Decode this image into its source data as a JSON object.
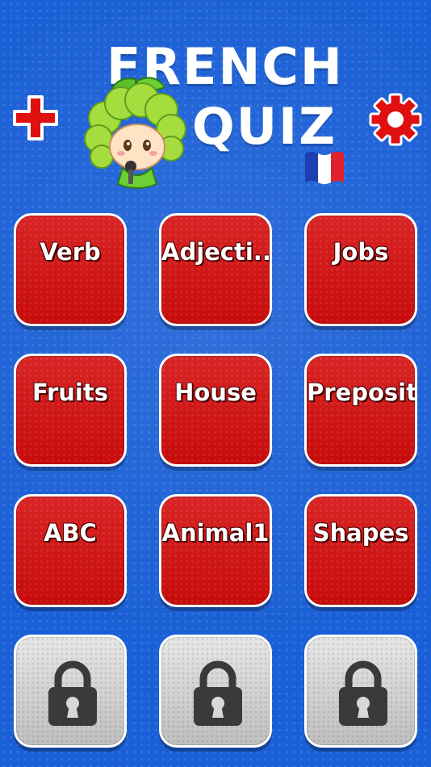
{
  "header": {
    "title_line1": "FRENCH",
    "title_line2": "QUIZ"
  },
  "icons": {
    "add": "plus-icon",
    "settings": "gear-icon",
    "mascot": "broccoli-mascot-icon",
    "flag": "french-flag-icon",
    "locked": "padlock-icon"
  },
  "colors": {
    "background": "#1a5fd6",
    "tile_red": "#d40c0c",
    "tile_locked": "#cfcfcf",
    "accent_red": "#e01010"
  },
  "categories": [
    {
      "label": "Verb"
    },
    {
      "label": "Adjecti..."
    },
    {
      "label": "Jobs"
    },
    {
      "label": "Fruits"
    },
    {
      "label": "House"
    },
    {
      "label": "Preposit..."
    },
    {
      "label": "ABC"
    },
    {
      "label": "Animal1"
    },
    {
      "label": "Shapes"
    }
  ],
  "locked_tiles": 3
}
